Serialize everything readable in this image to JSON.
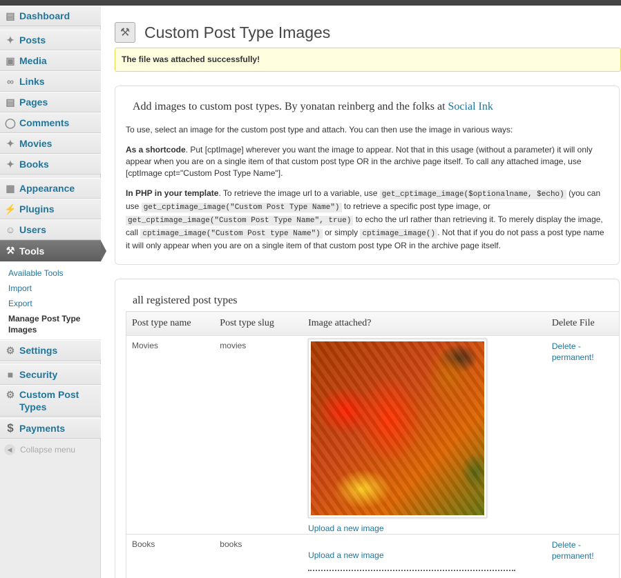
{
  "sidebar": {
    "items": [
      {
        "label": "Dashboard",
        "icon": "dashboard-icon"
      },
      {
        "label": "Posts",
        "icon": "pin-icon"
      },
      {
        "label": "Media",
        "icon": "media-icon"
      },
      {
        "label": "Links",
        "icon": "link-icon"
      },
      {
        "label": "Pages",
        "icon": "page-icon"
      },
      {
        "label": "Comments",
        "icon": "comment-icon"
      },
      {
        "label": "Movies",
        "icon": "pin-icon"
      },
      {
        "label": "Books",
        "icon": "pin-icon"
      },
      {
        "label": "Appearance",
        "icon": "appearance-icon"
      },
      {
        "label": "Plugins",
        "icon": "plugin-icon"
      },
      {
        "label": "Users",
        "icon": "users-icon"
      },
      {
        "label": "Tools",
        "icon": "tools-icon"
      },
      {
        "label": "Settings",
        "icon": "settings-icon"
      },
      {
        "label": "Security",
        "icon": "lock-icon"
      },
      {
        "label": "Custom Post Types",
        "icon": "gear-icon"
      },
      {
        "label": "Payments",
        "icon": "dollar-icon"
      }
    ],
    "tools_submenu": [
      "Available Tools",
      "Import",
      "Export",
      "Manage Post Type Images"
    ],
    "collapse_label": "Collapse menu"
  },
  "page": {
    "title": "Custom Post Type Images",
    "notice": "The file was attached successfully!"
  },
  "intro": {
    "heading_prefix": "Add images to custom post types. By yonatan reinberg and the folks at ",
    "heading_link": "Social Ink",
    "p1": "To use, select an image for the custom post type and attach. You can then use the image in various ways:",
    "p2_bold": "As a shortcode",
    "p2_text": ". Put [cptImage] wherever you want the image to appear. Not that in this usage (without a parameter) it will only appear when you are on a single item of that custom post type OR in the archive page itself. To call any attached image, use [cptImage cpt=\"Custom Post Type Name\"].",
    "p3_bold": "In PHP in your template",
    "p3_t1": ". To retrieve the image url to a variable, use ",
    "p3_c1": "get_cptimage_image($optionalname, $echo)",
    "p3_t2": " (you can use ",
    "p3_c2": "get_cptimage_image(\"Custom Post Type Name\")",
    "p3_t3": " to retrieve a specific post type image, or ",
    "p3_c3": "get_cptimage_image(\"Custom Post Type Name\", true)",
    "p3_t4": " to echo the url rather than retrieving it. To merely display the image, call ",
    "p3_c4": "cptimage_image(\"Custom Post type Name\")",
    "p3_t5": " or simply ",
    "p3_c5": "cptimage_image()",
    "p3_t6": ". Not that if you do not pass a post type name it will only appear when you are on a single item of that custom post type OR in the archive page itself."
  },
  "types": {
    "heading": "all registered post types",
    "columns": [
      "Post type name",
      "Post type slug",
      "Image attached?",
      "Delete File"
    ],
    "rows": [
      {
        "name": "Movies",
        "slug": "movies",
        "upload": "Upload a new image",
        "delete": "Delete - permanent!"
      },
      {
        "name": "Books",
        "slug": "books",
        "upload": "Upload a new image",
        "delete": "Delete - permanent!"
      }
    ]
  }
}
